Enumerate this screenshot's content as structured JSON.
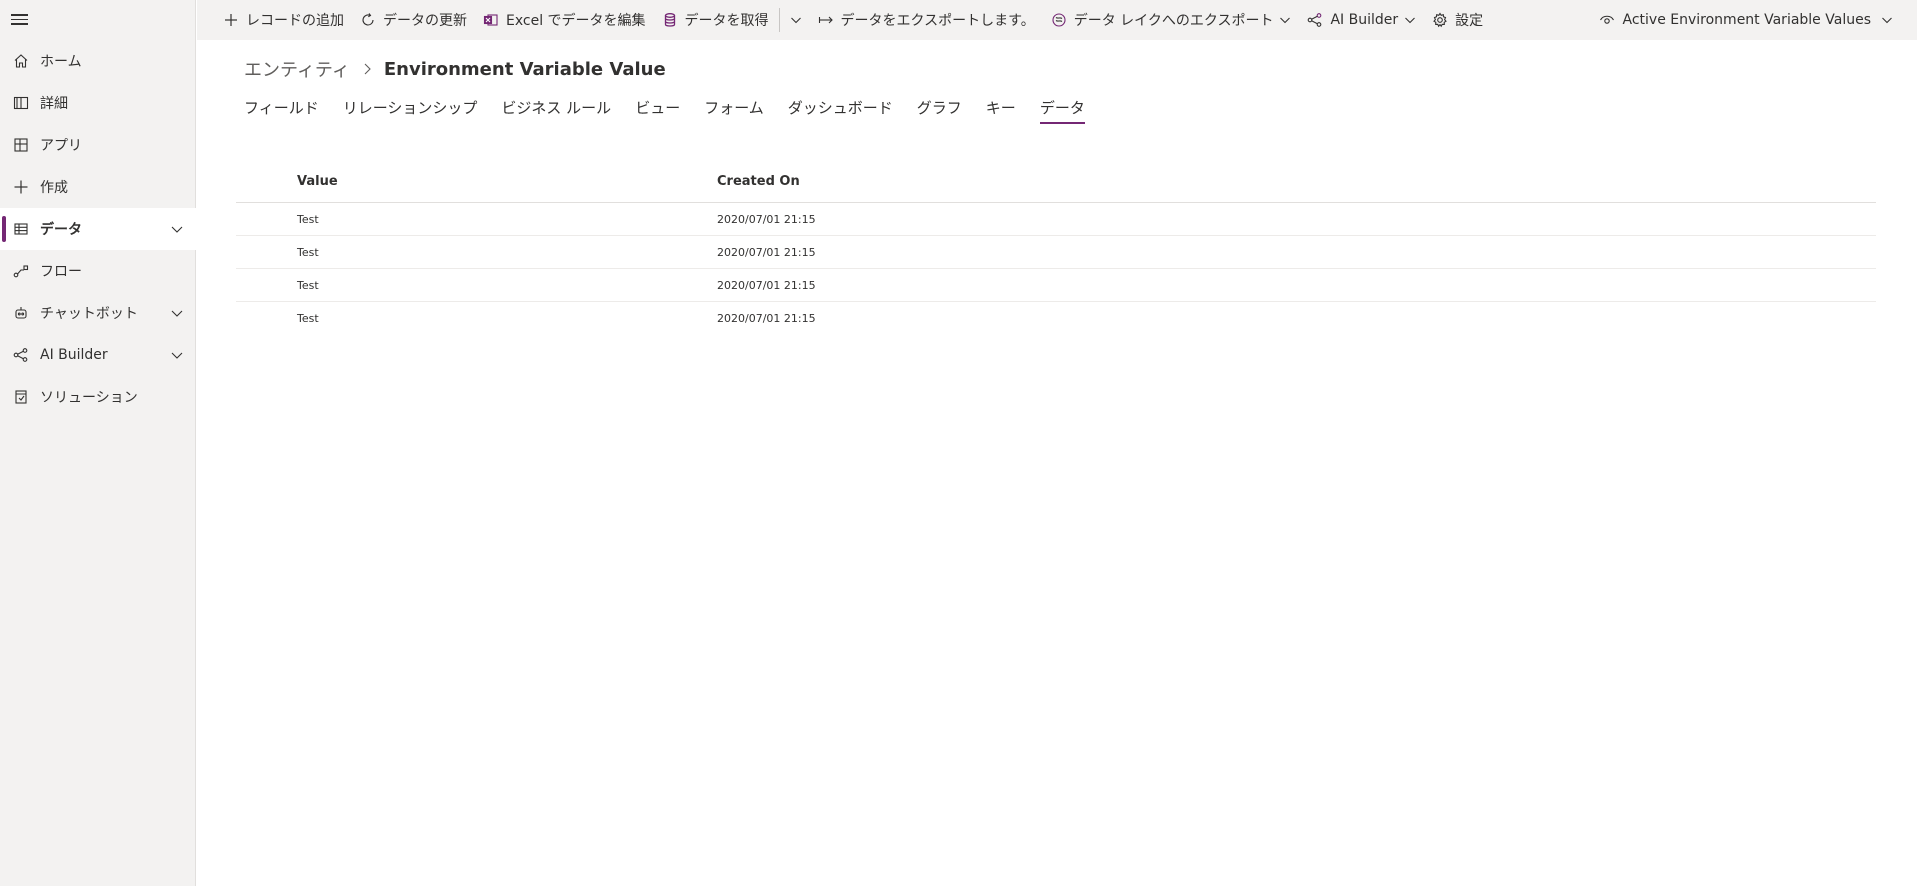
{
  "sidebar": {
    "items": [
      {
        "label": "ホーム",
        "icon": "home-icon"
      },
      {
        "label": "詳細",
        "icon": "book-icon"
      },
      {
        "label": "アプリ",
        "icon": "apps-icon"
      },
      {
        "label": "作成",
        "icon": "plus-icon"
      },
      {
        "label": "データ",
        "icon": "table-icon",
        "selected": true,
        "expandable": true
      },
      {
        "label": "フロー",
        "icon": "flow-icon"
      },
      {
        "label": "チャットボット",
        "icon": "bot-icon",
        "expandable": true
      },
      {
        "label": "AI Builder",
        "icon": "ai-builder-icon",
        "expandable": true
      },
      {
        "label": "ソリューション",
        "icon": "solution-icon"
      }
    ]
  },
  "commandbar": {
    "add_record": "レコードの追加",
    "refresh": "データの更新",
    "excel_edit": "Excel でデータを編集",
    "get_data": "データを取得",
    "export_data": "データをエクスポートします。",
    "export_lake": "データ レイクへのエクスポート",
    "ai_builder": "AI Builder",
    "settings": "設定",
    "view_selector": "Active Environment Variable Values"
  },
  "breadcrumb": {
    "parent": "エンティティ",
    "current": "Environment Variable Value"
  },
  "tabs": [
    "フィールド",
    "リレーションシップ",
    "ビジネス ルール",
    "ビュー",
    "フォーム",
    "ダッシュボード",
    "グラフ",
    "キー",
    "データ"
  ],
  "active_tab": "データ",
  "grid": {
    "columns": {
      "value": "Value",
      "created_on": "Created On"
    },
    "rows": [
      {
        "value": "Test",
        "created_on": "2020/07/01 21:15"
      },
      {
        "value": "Test",
        "created_on": "2020/07/01 21:15"
      },
      {
        "value": "Test",
        "created_on": "2020/07/01 21:15"
      },
      {
        "value": "Test",
        "created_on": "2020/07/01 21:15"
      }
    ]
  },
  "colors": {
    "accent": "#742774",
    "sidebar_bg": "#f3f2f1",
    "commandbar_bg": "#f3f2f1"
  }
}
